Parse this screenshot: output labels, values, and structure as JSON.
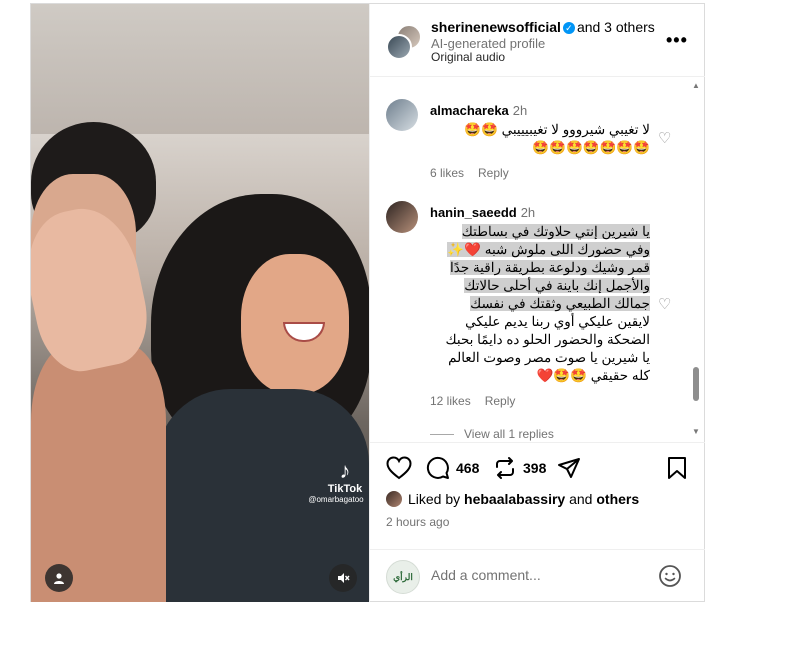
{
  "header": {
    "username": "sherinenewsofficial",
    "collab_text": "and 3 others",
    "subtitle": "AI-generated profile",
    "audio": "Original audio",
    "more_label": "•••"
  },
  "media": {
    "watermark_logo": "♪",
    "watermark_name": "TikTok",
    "watermark_handle": "@omarbagatoo"
  },
  "comments": [
    {
      "username": "almachareka",
      "time": "2h",
      "line1": "لا تغيبي شيرووو لا تغيبيييبي 🤩🤩",
      "line2": "🤩🤩🤩🤩🤩🤩🤩",
      "likes": "6 likes",
      "reply": "Reply"
    },
    {
      "username": "hanin_saeedd",
      "time": "2h",
      "lines": [
        "يا شيرين إنتي حلاوتك في بساطتك",
        "وفي حضورك اللى ملوش شبه ❤️✨",
        "قمر وشيك ودلوعة بطريقة راقية جدًا",
        "والأجمل إنك باينة في أحلى حالاتك",
        "جمالك الطبيعي وثقتك في نفسك",
        "لايقين عليكي أوي ربنا يديم عليكي",
        "الضحكة والحضور الحلو ده دايمًا بحبك",
        "يا شيرين يا صوت مصر وصوت العالم",
        "كله حقيقي 🤩🤩❤️"
      ],
      "likes": "12 likes",
      "reply": "Reply"
    }
  ],
  "view_replies": "View all 1 replies",
  "actions": {
    "comments_count": "468",
    "reposts_count": "398"
  },
  "liked_by": {
    "prefix": "Liked by",
    "user": "hebaalabassiry",
    "and": "and",
    "others": "others"
  },
  "time_ago": "2 hours ago",
  "add_comment": {
    "avatar_text": "الرأي",
    "placeholder": "Add a comment..."
  }
}
